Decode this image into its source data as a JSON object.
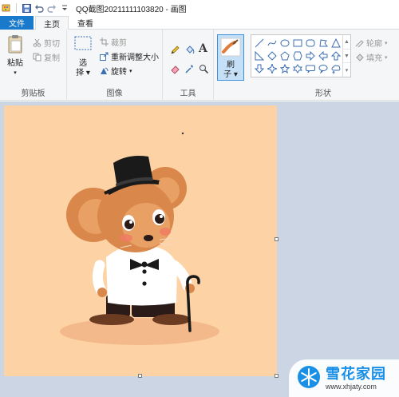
{
  "window": {
    "title": "QQ截图20211111103820 - 画图"
  },
  "tabs": {
    "file": "文件",
    "home": "主页",
    "view": "查看"
  },
  "clipboard": {
    "paste": "粘贴",
    "cut": "剪切",
    "copy": "复制",
    "label": "剪贴板"
  },
  "image": {
    "select_l1": "选",
    "select_l2": "择",
    "crop": "裁剪",
    "resize": "重新调整大小",
    "rotate": "旋转",
    "label": "图像"
  },
  "tools": {
    "text_glyph": "A",
    "label": "工具"
  },
  "brushes": {
    "l1": "刷",
    "l2": "子"
  },
  "shapes": {
    "outline": "轮廓",
    "fill": "填充",
    "label": "形状"
  },
  "watermark": {
    "title": "雪花家园",
    "url": "www.xhjaty.com"
  },
  "colors": {
    "accent": "#1979ca",
    "canvas": "#fdd2a5",
    "workspace": "#cbd5e4",
    "brush_highlight": "#c5e0f6"
  }
}
